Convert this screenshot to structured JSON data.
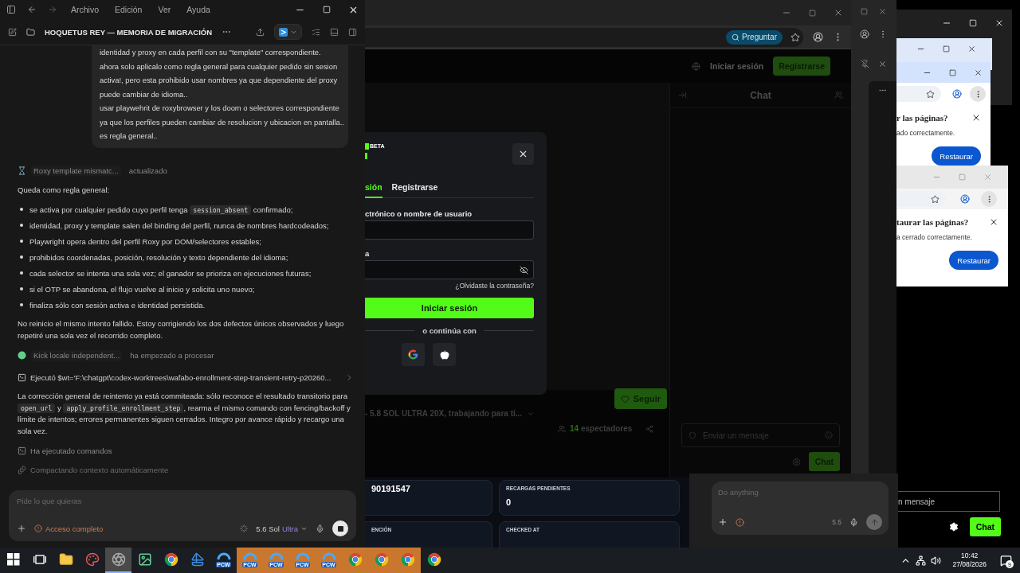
{
  "codex": {
    "menu": [
      "Archivo",
      "Edición",
      "Ver",
      "Ayuda"
    ],
    "title": "HOQUETUS REY — MEMORIA DE MIGRACIÓN",
    "user_message": [
      "identidad y proxy en cada perfil con su \"template\" correspondiente.",
      "ahora solo aplicalo como regla general para cualquier pedido sin sesion",
      "activa!, pero esta prohibido usar nombres ya que dependiente del proxy",
      "puede cambiar de idioma..",
      "usar playwehrit de roxybrowser y los doom o selectores correspondiente",
      "ya que los perfiles pueden cambiar de resolucion y ubicacion en pantalla..",
      "es regla general.."
    ],
    "blocks": [
      {
        "kind": "task_done",
        "name": "Roxy template mismatc...",
        "status": "actualizado"
      },
      {
        "kind": "paragraph",
        "parts": [
          {
            "kind": "text",
            "text": "Queda como regla general:"
          }
        ]
      },
      {
        "kind": "bullets",
        "items": [
          [
            {
              "kind": "text",
              "text": "se activa por cualquier pedido cuyo perfil tenga "
            },
            {
              "kind": "code",
              "text": "session_absent"
            },
            {
              "kind": "text",
              "text": " confirmado;"
            }
          ],
          [
            {
              "kind": "text",
              "text": "identidad, proxy y template salen del binding del perfil, nunca de nombres hardcodeados;"
            }
          ],
          [
            {
              "kind": "text",
              "text": "Playwright opera dentro del perfil Roxy por DOM/selectores estables;"
            }
          ],
          [
            {
              "kind": "text",
              "text": "prohibidos coordenadas, posición, resolución y texto dependiente del idioma;"
            }
          ],
          [
            {
              "kind": "text",
              "text": "cada selector se intenta una sola vez; el ganador se prioriza en ejecuciones futuras;"
            }
          ],
          [
            {
              "kind": "text",
              "text": "si el OTP se abandona, el flujo vuelve al inicio y solicita uno nuevo;"
            }
          ],
          [
            {
              "kind": "text",
              "text": "finaliza sólo con sesión activa e identidad persistida."
            }
          ]
        ]
      },
      {
        "kind": "paragraph",
        "parts": [
          {
            "kind": "text",
            "text": "No reinicio el mismo intento fallido. Estoy corrigiendo los dos defectos únicos observados y luego repetiré una sola vez el recorrido completo."
          }
        ]
      },
      {
        "kind": "task_active",
        "name": "Kick locale independent...",
        "status": "ha empezado a procesar"
      },
      {
        "kind": "command",
        "text": "Ejecutó $wt='F:\\chatgpt\\codex-worktrees\\wafabo-enrollment-step-transient-retry-p20260..."
      },
      {
        "kind": "paragraph",
        "parts": [
          {
            "kind": "text",
            "text": "La corrección general de reintento ya está commiteada: sólo reconoce el resultado transitorio para "
          },
          {
            "kind": "code",
            "text": "open_url"
          },
          {
            "kind": "text",
            "text": " y "
          },
          {
            "kind": "code",
            "text": "apply_profile_enrollment_step"
          },
          {
            "kind": "text",
            "text": ", rearma el mismo comando con fencing/backoff y límite de intentos; errores permanentes siguen cerrados. Integro por avance rápido y recargo una sola vez."
          }
        ]
      },
      {
        "kind": "commands",
        "text": "Ha ejecutado comandos",
        "dim": false
      },
      {
        "kind": "compacting",
        "text": "Compactando contexto automáticamente",
        "dim": true
      }
    ],
    "composer": {
      "placeholder": "Pide lo que quieras",
      "access": "Acceso completo",
      "model": "5.6 Sol",
      "effort": "Ultra"
    }
  },
  "browser": {
    "ask_button": "Preguntar",
    "nav": {
      "login": "Iniciar sesión",
      "register": "Registrarse"
    },
    "stream": {
      "follow": "Seguir",
      "title": "- 5.8 SOL ULTRA 20X, trabajando para ti...",
      "viewers_count": "14",
      "viewers_label": "espectadores"
    },
    "chat": {
      "title": "Chat",
      "placeholder": "Enviar un mensaje",
      "send": "Chat"
    },
    "modal": {
      "badge": "BETA",
      "tabs": [
        {
          "label": "sión",
          "selected": true
        },
        {
          "label": "Registrarse",
          "selected": false
        }
      ],
      "email_label": "ctrónico o nombre de usuario",
      "password_label": "a",
      "forgot": "¿Olvidaste la contraseña?",
      "submit": "Iniciar sesión",
      "divider": "o continúa con"
    }
  },
  "dashboard": {
    "cards": [
      {
        "value": "90191547"
      },
      {
        "label": "RECARGAS PENDIENTES",
        "value": "0"
      },
      {
        "label": "ENCIÓN"
      },
      {
        "label": "CHECKED AT"
      }
    ]
  },
  "assistant": {
    "placeholder": "Do anything",
    "model": "5.5"
  },
  "restore_dialogs": [
    {
      "title": "r las páginas?",
      "body": "ado correctamente.",
      "button": "Restaurar"
    },
    {
      "title": "taurar las páginas?",
      "body": "a cerrado correctamente.",
      "button": "Restaurar"
    }
  ],
  "side_chat": {
    "placeholder": "n mensaje",
    "send": "Chat"
  },
  "taskbar": {
    "apps": [
      {
        "kind": "start",
        "selected": false,
        "flashing": false
      },
      {
        "kind": "taskview",
        "selected": false,
        "flashing": false
      },
      {
        "kind": "folder",
        "selected": false,
        "flashing": false
      },
      {
        "kind": "paint",
        "selected": false,
        "flashing": false
      },
      {
        "kind": "aperture",
        "selected": true,
        "flashing": false
      },
      {
        "kind": "image",
        "selected": false,
        "flashing": false
      },
      {
        "kind": "chrome",
        "selected": false,
        "flashing": false
      },
      {
        "kind": "sail",
        "selected": false,
        "flashing": false
      },
      {
        "kind": "pcw",
        "label": "PCW",
        "selected": false,
        "flashing": false
      },
      {
        "kind": "pcw",
        "label": "PCW",
        "selected": false,
        "flashing": true
      },
      {
        "kind": "pcw",
        "label": "PCW",
        "selected": false,
        "flashing": true
      },
      {
        "kind": "pcw",
        "label": "PCW",
        "selected": false,
        "flashing": true
      },
      {
        "kind": "pcw",
        "label": "PCW",
        "selected": false,
        "flashing": true
      },
      {
        "kind": "chrome",
        "selected": false,
        "flashing": true
      },
      {
        "kind": "chrome",
        "selected": false,
        "flashing": true
      },
      {
        "kind": "chrome",
        "selected": false,
        "flashing": true
      },
      {
        "kind": "chrome",
        "selected": false,
        "flashing": false
      }
    ],
    "time": "10:42",
    "date": "27/08/2026",
    "notifications": "9"
  }
}
